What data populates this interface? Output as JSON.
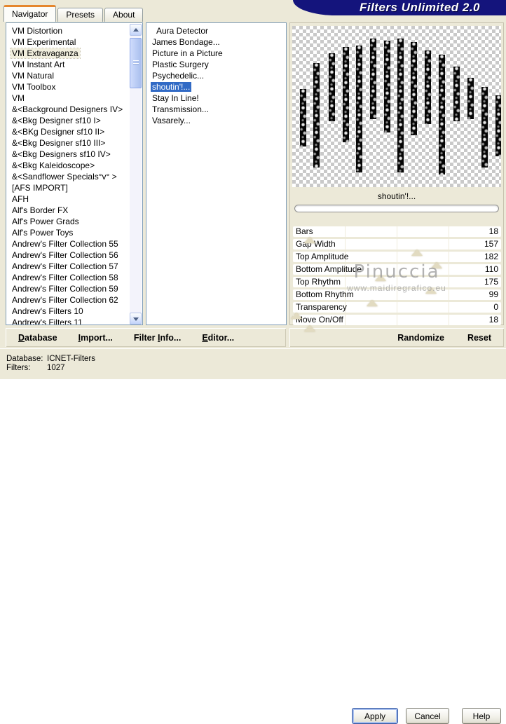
{
  "window": {
    "title": "Filters Unlimited 2.0"
  },
  "colors": {
    "background": "#ece9d8",
    "banner_navy": "#14147c",
    "selection_blue": "#316ac5",
    "inactive_selection": "#f1eedd",
    "tab_accent_orange": "#e5862d"
  },
  "tabs": [
    {
      "label": "Navigator",
      "active": true
    },
    {
      "label": "Presets",
      "active": false
    },
    {
      "label": "About",
      "active": false
    }
  ],
  "category_list": {
    "selected_index": 2,
    "items": [
      "VM Distortion",
      "VM Experimental",
      "VM Extravaganza",
      "VM Instant Art",
      "VM Natural",
      "VM Toolbox",
      "VM",
      "&<Background Designers IV>",
      "&<Bkg Designer sf10 I>",
      "&<BKg Designer sf10 II>",
      "&<Bkg Designer sf10 III>",
      "&<Bkg Designers sf10 IV>",
      "&<Bkg Kaleidoscope>",
      "&<Sandflower Specials°v° >",
      "[AFS IMPORT]",
      "AFH",
      "Alf's Border FX",
      "Alf's Power Grads",
      "Alf's Power Toys",
      "Andrew's Filter Collection 55",
      "Andrew's Filter Collection 56",
      "Andrew's Filter Collection 57",
      "Andrew's Filter Collection 58",
      "Andrew's Filter Collection 59",
      "Andrew's Filter Collection 62",
      "Andrew's Filters 10",
      "Andrew's Filters 11"
    ]
  },
  "filter_list": {
    "selected_index": 5,
    "items": [
      "Aura Detector",
      "James Bondage...",
      "Picture in a Picture",
      "Plastic Surgery",
      "Psychedelic...",
      "shoutin'!...",
      "Stay In Line!",
      "Transmission...",
      "Vasarely..."
    ]
  },
  "preview": {
    "filter_name": "shoutin'!...",
    "progress_percent": 0,
    "bars": [
      [
        3.8,
        39,
        36
      ],
      [
        10.1,
        23,
        65
      ],
      [
        17.5,
        17,
        42
      ],
      [
        24.2,
        13,
        59
      ],
      [
        30.7,
        12,
        79
      ],
      [
        37.3,
        8,
        50
      ],
      [
        43.9,
        9,
        57
      ],
      [
        50.4,
        8,
        83
      ],
      [
        56.7,
        10,
        58
      ],
      [
        63.4,
        15,
        46
      ],
      [
        70.0,
        18,
        74
      ],
      [
        77.2,
        25,
        34
      ],
      [
        83.9,
        32,
        26
      ],
      [
        90.5,
        38,
        50
      ],
      [
        97.2,
        43,
        38
      ]
    ]
  },
  "sliders": {
    "max": 255,
    "items": [
      {
        "label": "Bars",
        "value": 18
      },
      {
        "label": "Gap Width",
        "value": 157
      },
      {
        "label": "Top Amplitude",
        "value": 182
      },
      {
        "label": "Bottom Amplitude",
        "value": 110
      },
      {
        "label": "Top Rhythm",
        "value": 175
      },
      {
        "label": "Bottom Rhythm",
        "value": 99
      },
      {
        "label": "Transparency",
        "value": 0
      },
      {
        "label": "Move On/Off",
        "value": 18
      }
    ]
  },
  "watermark": {
    "line1": "Pinuccia",
    "line2": "www.maidiregrafico.eu"
  },
  "action_bar": {
    "left": [
      {
        "name": "database",
        "pre": "",
        "mn": "D",
        "post": "atabase"
      },
      {
        "name": "import",
        "pre": "",
        "mn": "I",
        "post": "mport..."
      },
      {
        "name": "filter-info",
        "pre": "Filter ",
        "mn": "I",
        "post": "nfo..."
      },
      {
        "name": "editor",
        "pre": "",
        "mn": "E",
        "post": "ditor..."
      }
    ],
    "right": [
      {
        "name": "randomize",
        "pre": "",
        "mn": "",
        "post": "Randomize"
      },
      {
        "name": "reset",
        "pre": "",
        "mn": "",
        "post": "Reset"
      }
    ]
  },
  "status": {
    "database_label": "Database:",
    "database_value": "ICNET-Filters",
    "filters_label": "Filters:",
    "filters_value": "1027"
  },
  "dialog_buttons": {
    "apply": "Apply",
    "cancel": "Cancel",
    "help": "Help"
  }
}
